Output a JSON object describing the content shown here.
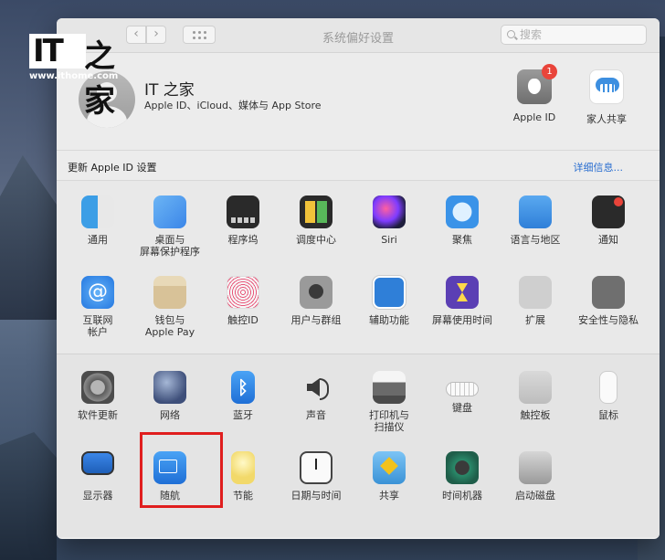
{
  "watermark": {
    "brand_text": "IT",
    "brand_char": "之家",
    "url": "www.ithome.com"
  },
  "window": {
    "title": "系统偏好设置",
    "search_placeholder": "搜索"
  },
  "account": {
    "name": "IT 之家",
    "subtitle": "Apple ID、iCloud、媒体与 App Store",
    "apple_id_label": "Apple ID",
    "apple_id_badge": "1",
    "family_label": "家人共享"
  },
  "update_bar": {
    "text": "更新 Apple ID 设置",
    "link": "详细信息..."
  },
  "row1": [
    {
      "label": "通用"
    },
    {
      "label": "桌面与\n屏幕保护程序"
    },
    {
      "label": "程序坞"
    },
    {
      "label": "调度中心"
    },
    {
      "label": "Siri"
    },
    {
      "label": "聚焦"
    },
    {
      "label": "语言与地区"
    },
    {
      "label": "通知"
    }
  ],
  "row2": [
    {
      "label": "互联网\n帐户"
    },
    {
      "label": "钱包与\nApple Pay"
    },
    {
      "label": "触控ID"
    },
    {
      "label": "用户与群组"
    },
    {
      "label": "辅助功能"
    },
    {
      "label": "屏幕使用时间"
    },
    {
      "label": "扩展"
    },
    {
      "label": "安全性与隐私"
    }
  ],
  "row3": [
    {
      "label": "软件更新"
    },
    {
      "label": "网络"
    },
    {
      "label": "蓝牙"
    },
    {
      "label": "声音"
    },
    {
      "label": "打印机与\n扫描仪"
    },
    {
      "label": "键盘"
    },
    {
      "label": "触控板"
    },
    {
      "label": "鼠标"
    }
  ],
  "row4": [
    {
      "label": "显示器"
    },
    {
      "label": "随航"
    },
    {
      "label": "节能"
    },
    {
      "label": "日期与时间"
    },
    {
      "label": "共享"
    },
    {
      "label": "时间机器"
    },
    {
      "label": "启动磁盘"
    }
  ],
  "colors": {
    "highlight": "#e01e1e",
    "link": "#2a6ed0",
    "badge": "#e9443a"
  }
}
